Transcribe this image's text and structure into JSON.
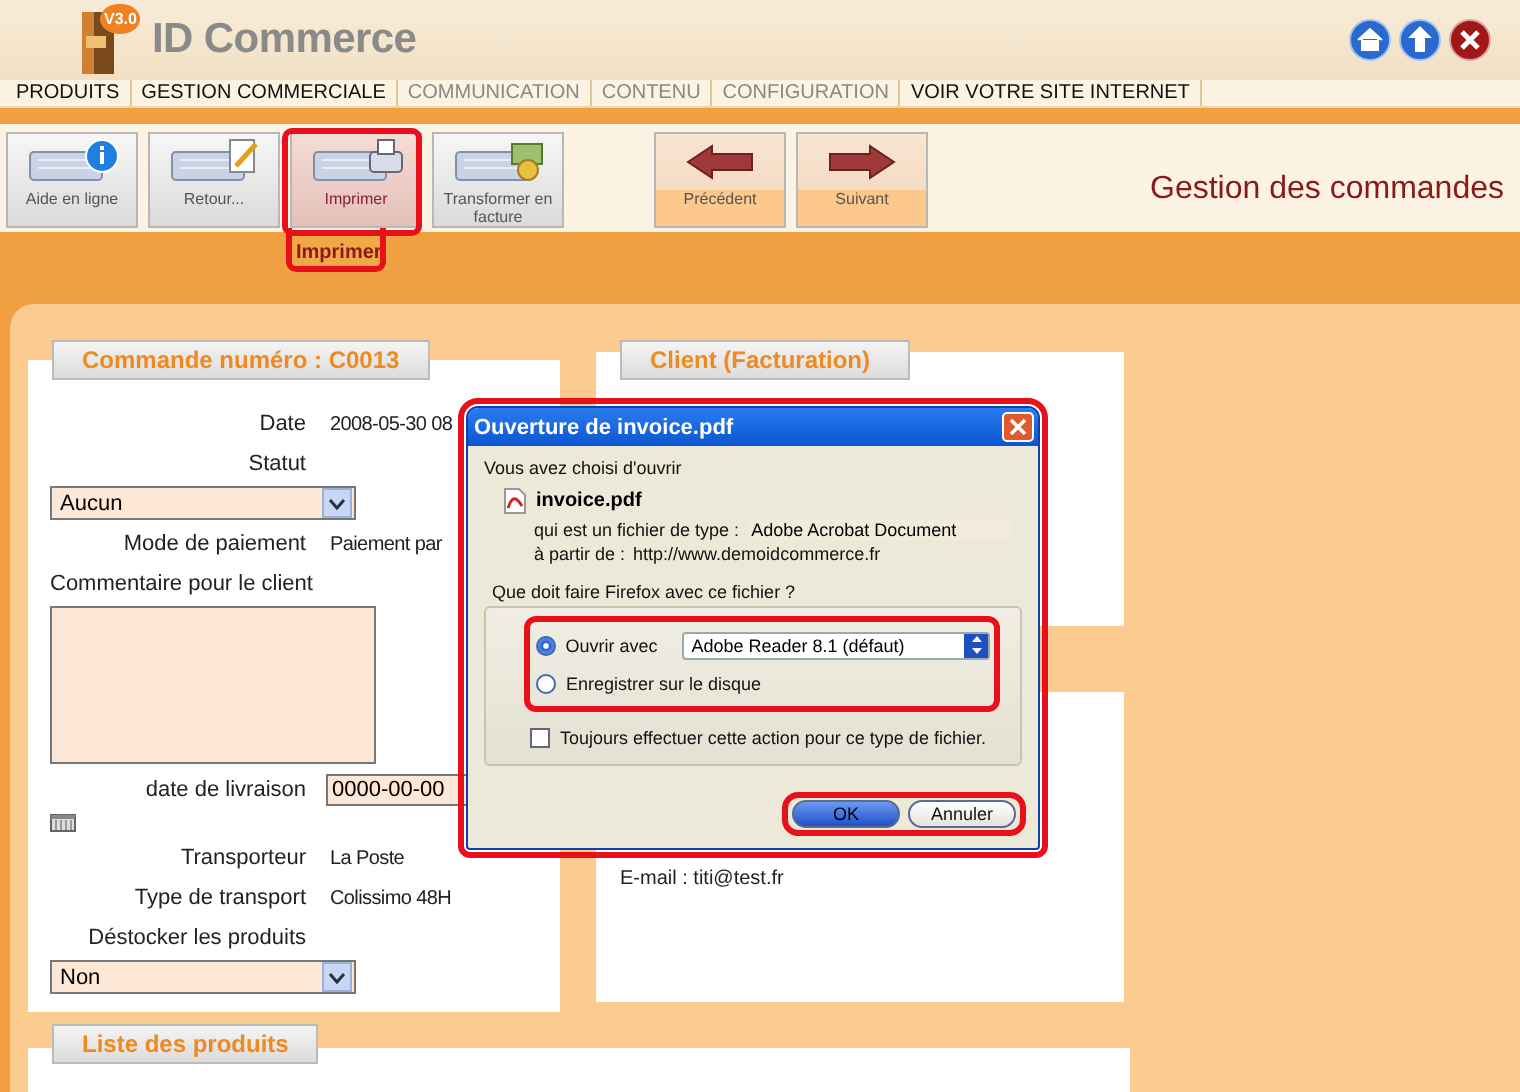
{
  "header": {
    "logo_badge": "V3.0",
    "brand": "ID Commerce"
  },
  "nav": [
    {
      "label": "PRODUITS",
      "disabled": false
    },
    {
      "label": "GESTION COMMERCIALE",
      "disabled": false
    },
    {
      "label": "COMMUNICATION",
      "disabled": true
    },
    {
      "label": "CONTENU",
      "disabled": true
    },
    {
      "label": "CONFIGURATION",
      "disabled": true
    },
    {
      "label": "VOIR VOTRE SITE INTERNET",
      "disabled": false
    }
  ],
  "toolbar": {
    "buttons": [
      {
        "label": "Aide en ligne",
        "kind": "tool",
        "selected": false
      },
      {
        "label": "Retour...",
        "kind": "tool",
        "selected": false
      },
      {
        "label": "Imprimer",
        "kind": "tool",
        "selected": true
      },
      {
        "label": "Transformer en facture",
        "kind": "tool",
        "selected": false
      },
      {
        "label": "Précédent",
        "kind": "nav",
        "selected": false
      },
      {
        "label": "Suivant",
        "kind": "nav",
        "selected": false
      }
    ],
    "tooltip": "Imprimer",
    "page_title": "Gestion des commandes"
  },
  "order": {
    "heading": "Commande numéro : C0013",
    "fields": [
      {
        "kind": "text",
        "label": "Date",
        "value": "2008-05-30 08"
      },
      {
        "kind": "label",
        "label": "Statut"
      },
      {
        "kind": "select",
        "value": "Aucun"
      },
      {
        "kind": "text",
        "label": "Mode de paiement",
        "value": "Paiement par"
      },
      {
        "kind": "label",
        "label": "Commentaire pour le client"
      },
      {
        "kind": "textarea"
      },
      {
        "kind": "input",
        "label": "date de livraison",
        "value": "0000-00-00"
      },
      {
        "kind": "calendar"
      },
      {
        "kind": "text",
        "label": "Transporteur",
        "value": "La Poste"
      },
      {
        "kind": "text",
        "label": "Type de transport",
        "value": "Colissimo 48H"
      },
      {
        "kind": "label",
        "label": "Déstocker les produits"
      },
      {
        "kind": "select",
        "value": "Non"
      }
    ]
  },
  "billing": {
    "heading": "Client (Facturation)"
  },
  "client_info": {
    "email": "E-mail : titi@test.fr"
  },
  "products": {
    "heading": "Liste des produits"
  },
  "dialog": {
    "title": "Ouverture de invoice.pdf",
    "intro": "Vous avez choisi d'ouvrir",
    "file_name": "invoice.pdf",
    "type_label": "qui est un fichier de type :",
    "type_value": "Adobe Acrobat Document",
    "source_label": "à partir de :",
    "source_value": "http://www.demoidcommerce.fr",
    "question": "Que doit faire Firefox avec ce fichier ?",
    "options": [
      {
        "label": "Ouvrir avec",
        "selected": true,
        "app": "Adobe Reader 8.1 (défaut)"
      },
      {
        "label": "Enregistrer sur le disque",
        "selected": false
      }
    ],
    "always": {
      "label": "Toujours effectuer cette action pour ce type de fichier.",
      "checked": false
    },
    "buttons": [
      {
        "label": "OK",
        "kind": "default"
      },
      {
        "label": "Annuler",
        "kind": "normal"
      }
    ]
  }
}
